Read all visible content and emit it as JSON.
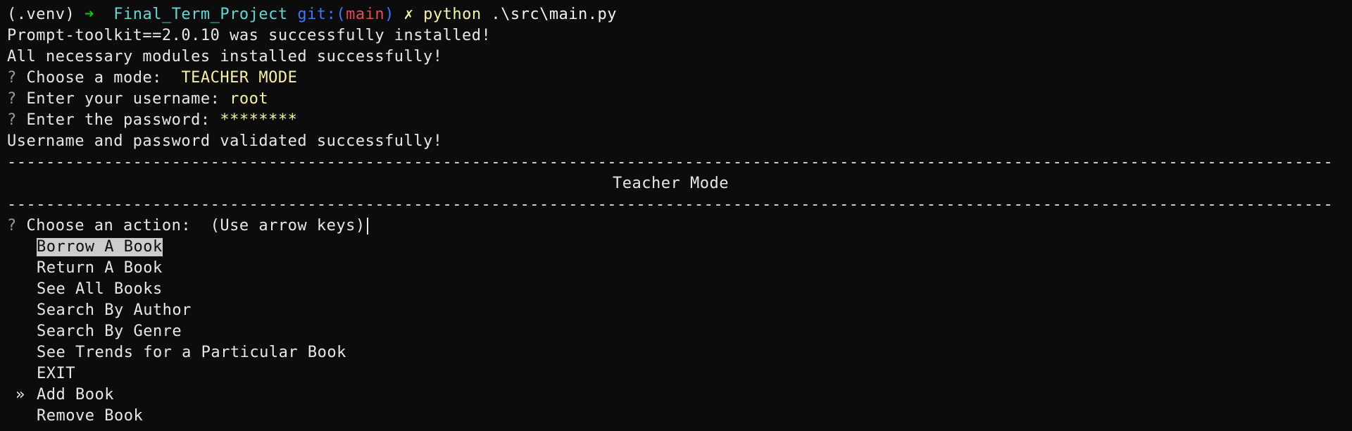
{
  "prompt_line": {
    "venv": "(.venv)",
    "arrow": "➜",
    "dir": "Final_Term_Project",
    "git_label": "git:(",
    "branch": "main",
    "git_close": ")",
    "dirty": "✗",
    "command": "python",
    "args": ".\\src\\main.py"
  },
  "output": {
    "line1": "Prompt-toolkit==2.0.10 was successfully installed!",
    "line2": "All necessary modules installed successfully!"
  },
  "questions": {
    "q_mark": "?",
    "mode_label": "Choose a mode: ",
    "mode_value": "TEACHER MODE",
    "username_label": "Enter your username:",
    "username_value": "root",
    "password_label": "Enter the password:",
    "password_value": "********"
  },
  "validated": "Username and password validated successfully!",
  "divider": "------------------------------------------------------------------------------------------------------------------------------------------------------------",
  "section_title": "Teacher Mode",
  "action_prompt": {
    "q_mark": "?",
    "label": "Choose an action: ",
    "hint": "(Use arrow keys)"
  },
  "menu": {
    "pointer": "»",
    "items": [
      "Borrow A Book",
      "Return A Book",
      "See All Books",
      "Search By Author",
      "Search By Genre",
      "See Trends for a Particular Book",
      "EXIT",
      "Add Book",
      "Remove Book"
    ]
  }
}
